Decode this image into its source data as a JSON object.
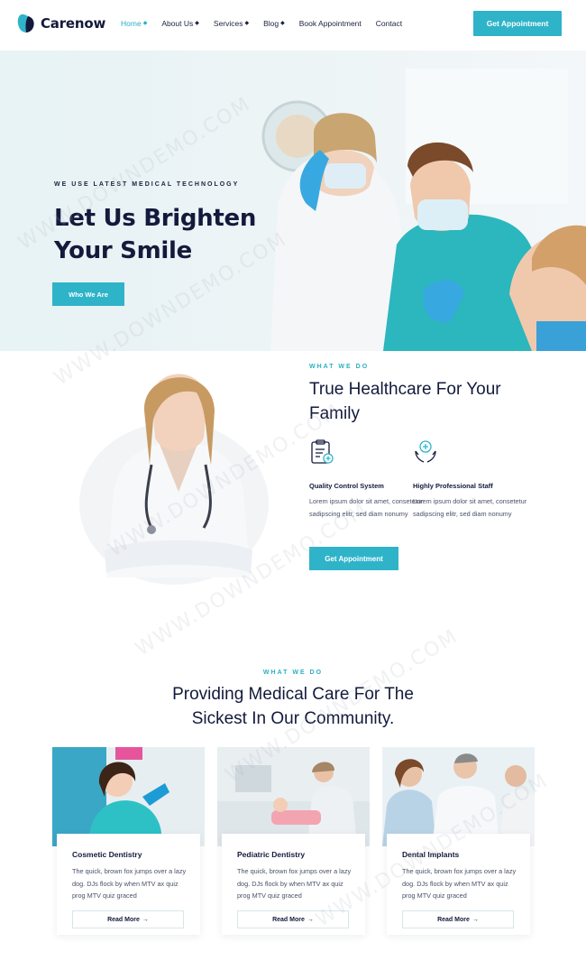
{
  "brand": {
    "name": "Carenow",
    "accent": "#2fb3c9",
    "dark": "#131a3b"
  },
  "nav": {
    "items": [
      {
        "label": "Home",
        "dropdown": true,
        "active": true
      },
      {
        "label": "About Us",
        "dropdown": true
      },
      {
        "label": "Services",
        "dropdown": true
      },
      {
        "label": "Blog",
        "dropdown": true
      },
      {
        "label": "Book Appointment",
        "dropdown": false
      },
      {
        "label": "Contact",
        "dropdown": false
      }
    ],
    "cta": "Get Appointment"
  },
  "hero": {
    "eyebrow": "WE USE LATEST MEDICAL TECHNOLOGY",
    "title": "Let Us Brighten Your Smile",
    "button": "Who We Are"
  },
  "about": {
    "eyebrow": "WHAT WE DO",
    "title": "True Healthcare For Your Family",
    "features": [
      {
        "icon": "clipboard-icon",
        "title": "Quality Control System",
        "text": "Lorem ipsum dolor sit amet, consetetur sadipscing elitr, sed diam nonumy"
      },
      {
        "icon": "care-hands-icon",
        "title": "Highly Professional Staff",
        "text": "Lorem ipsum dolor sit amet, consetetur sadipscing elitr, sed diam nonumy"
      }
    ],
    "button": "Get Appointment"
  },
  "services": {
    "eyebrow": "WHAT WE DO",
    "title": "Providing Medical Care For The Sickest In Our Community.",
    "cards": [
      {
        "title": "Cosmetic Dentistry",
        "text": "The quick, brown fox jumps over a lazy dog. DJs flock by when MTV ax quiz prog MTV quiz graced",
        "button": "Read More"
      },
      {
        "title": "Pediatric Dentistry",
        "text": "The quick, brown fox jumps over a lazy dog. DJs flock by when MTV ax quiz prog MTV quiz graced",
        "button": "Read More"
      },
      {
        "title": "Dental Implants",
        "text": "The quick, brown fox jumps over a lazy dog. DJs flock by when MTV ax quiz prog MTV quiz graced",
        "button": "Read More"
      }
    ]
  },
  "watermark": "WWW.DOWNDEMO.COM"
}
